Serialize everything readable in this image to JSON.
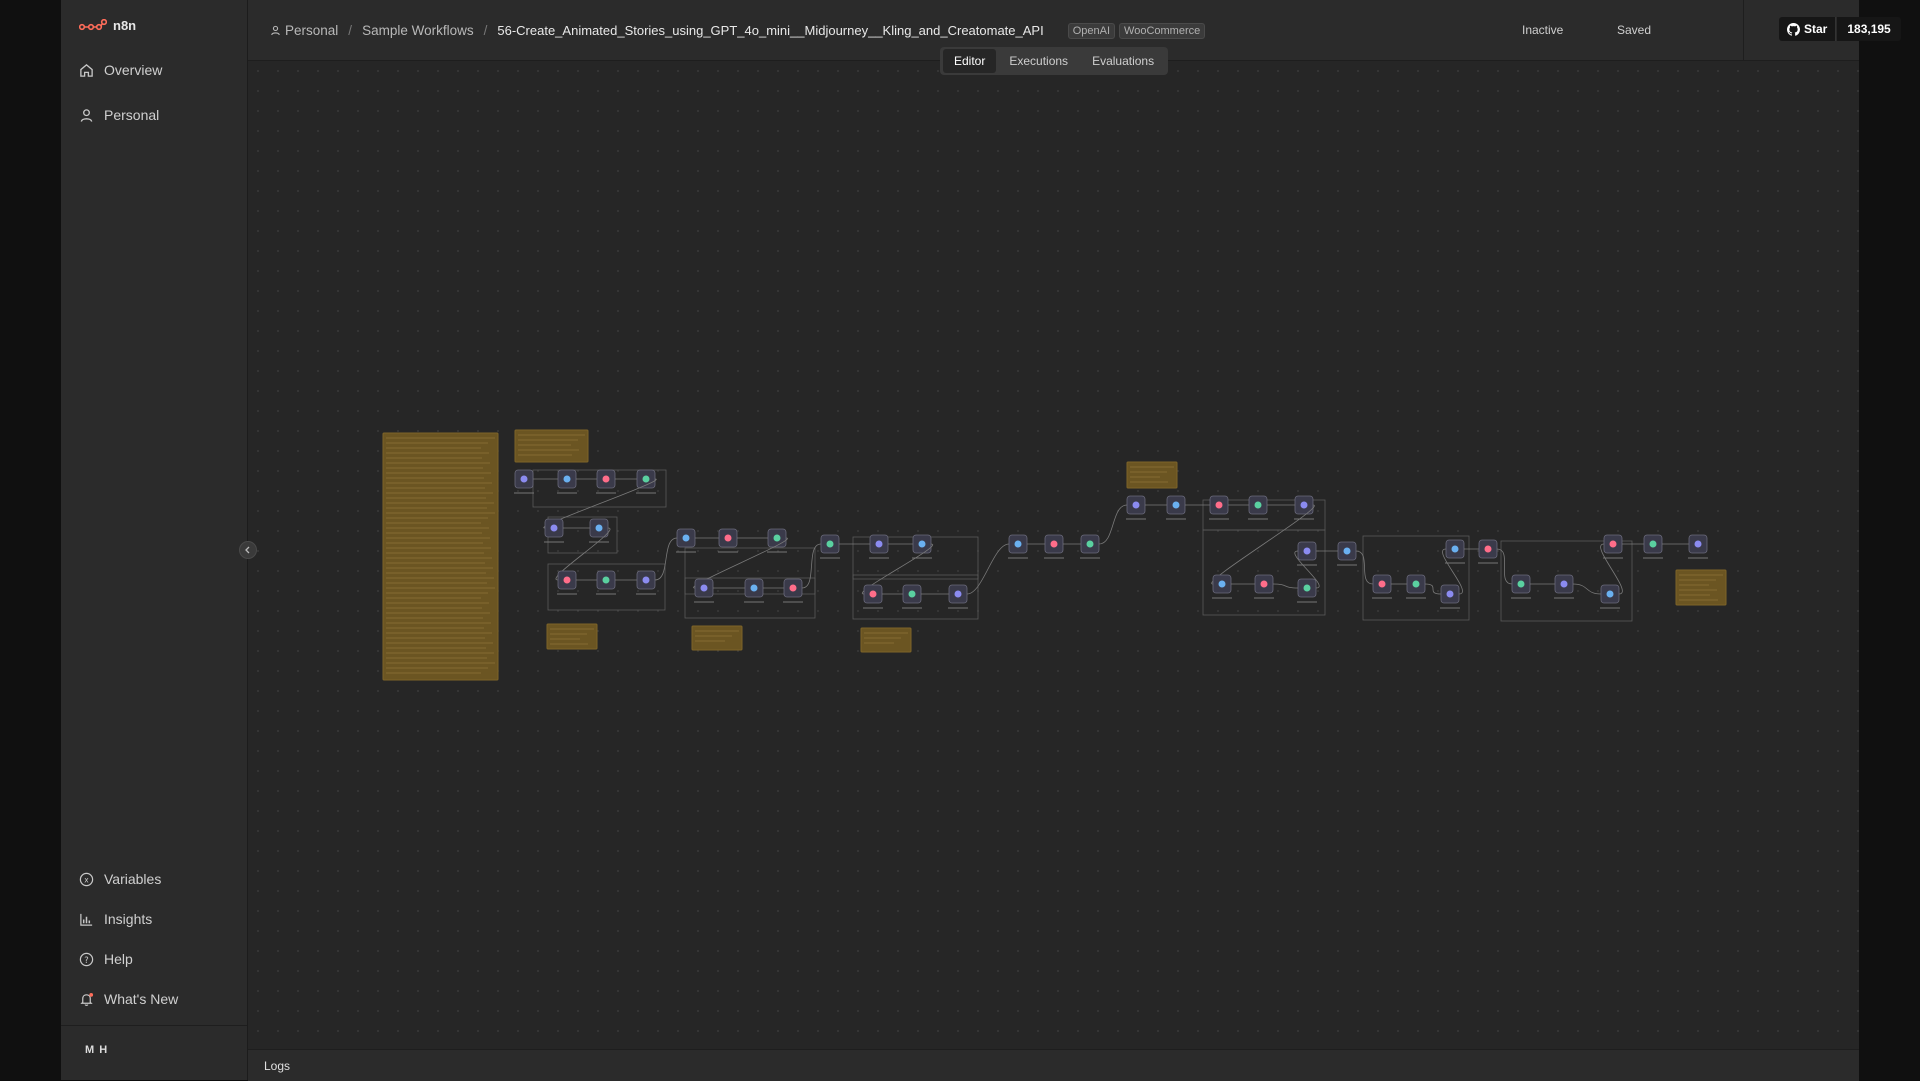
{
  "app": {
    "name": "n8n"
  },
  "sidebar": {
    "top_items": [
      {
        "label": "Overview",
        "icon": "home-icon"
      },
      {
        "label": "Personal",
        "icon": "user-icon"
      }
    ],
    "bottom_items": [
      {
        "label": "Variables",
        "icon": "variables-icon"
      },
      {
        "label": "Insights",
        "icon": "chart-icon"
      },
      {
        "label": "Help",
        "icon": "help-icon"
      },
      {
        "label": "What's New",
        "icon": "bell-icon"
      }
    ],
    "user_initials": "M H"
  },
  "header": {
    "breadcrumb": [
      "Personal",
      "Sample Workflows"
    ],
    "workflow_title": "56-Create_Animated_Stories_using_GPT_4o_mini__Midjourney__Kling_and_Creatomate_API",
    "tags": [
      "OpenAI",
      "WooCommerce"
    ],
    "active_state": "Inactive",
    "save_state": "Saved",
    "github": {
      "label": "Star",
      "count": "183,195"
    }
  },
  "tabs": [
    "Editor",
    "Executions",
    "Evaluations"
  ],
  "active_tab": "Editor",
  "logs_label": "Logs",
  "colors": {
    "sticky_note": "#6b5522",
    "node_bg": "#3a3a4a",
    "canvas_bg": "#262626",
    "accent": "#ff6d5a"
  }
}
